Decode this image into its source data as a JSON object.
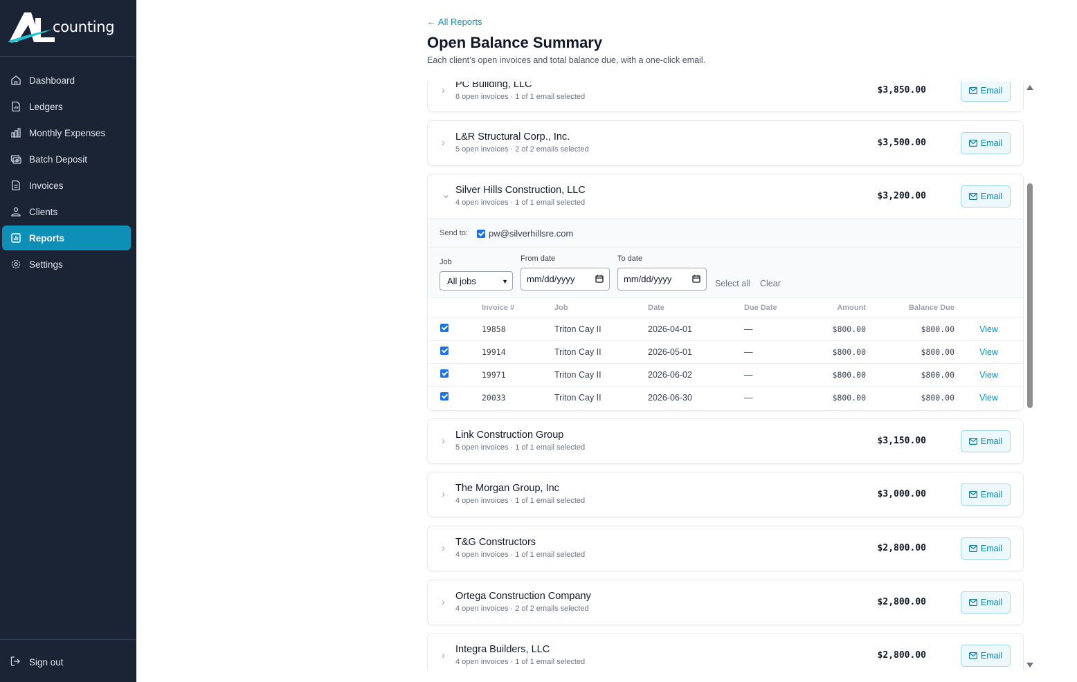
{
  "app": {
    "logo_letters": "AL",
    "logo_text": "counting"
  },
  "sidebar": {
    "items": [
      {
        "label": "Dashboard",
        "icon": "home-icon"
      },
      {
        "label": "Ledgers",
        "icon": "ledger-icon"
      },
      {
        "label": "Monthly Expenses",
        "icon": "bar-chart-icon"
      },
      {
        "label": "Batch Deposit",
        "icon": "deposit-icon"
      },
      {
        "label": "Invoices",
        "icon": "document-icon"
      },
      {
        "label": "Clients",
        "icon": "users-icon"
      },
      {
        "label": "Reports",
        "icon": "report-icon",
        "active": true
      },
      {
        "label": "Settings",
        "icon": "gear-icon"
      }
    ],
    "signout_label": "Sign out"
  },
  "header": {
    "back_link": "← All Reports",
    "title": "Open Balance Summary",
    "subtitle": "Each client’s open invoices and total balance due, with a one-click email."
  },
  "email_button_label": "Email",
  "clients": [
    {
      "name": "PC Building, LLC",
      "meta": "6 open invoices · 1 of 1 email selected",
      "balance": "$3,850.00"
    },
    {
      "name": "L&R Structural Corp., Inc.",
      "meta": "5 open invoices · 2 of 2 emails selected",
      "balance": "$3,500.00"
    },
    {
      "name": "Silver Hills Construction, LLC",
      "meta": "4 open invoices · 1 of 1 email selected",
      "balance": "$3,200.00",
      "expanded": true
    },
    {
      "name": "Link Construction Group",
      "meta": "5 open invoices · 1 of 1 email selected",
      "balance": "$3,150.00"
    },
    {
      "name": "The Morgan Group, Inc",
      "meta": "4 open invoices · 1 of 1 email selected",
      "balance": "$3,000.00"
    },
    {
      "name": "T&G Constructors",
      "meta": "4 open invoices · 1 of 1 email selected",
      "balance": "$2,800.00"
    },
    {
      "name": "Ortega Construction Company",
      "meta": "4 open invoices · 2 of 2 emails selected",
      "balance": "$2,800.00"
    },
    {
      "name": "Integra Builders, LLC",
      "meta": "4 open invoices · 1 of 1 email selected",
      "balance": "$2,800.00"
    }
  ],
  "expanded": {
    "send_to_label": "Send to:",
    "send_to_email": "pw@silverhillsre.com",
    "job_label": "Job",
    "job_value": "All jobs",
    "from_label": "From date",
    "to_label": "To date",
    "date_placeholder": "mm/dd/yyyy",
    "select_all": "Select all",
    "clear": "Clear",
    "columns": [
      "Invoice #",
      "Job",
      "Date",
      "Due Date",
      "Amount",
      "Balance Due"
    ],
    "rows": [
      {
        "invoice": "19858",
        "job": "Triton Cay II",
        "date": "2026-04-01",
        "due": "—",
        "amount": "$800.00",
        "balance": "$800.00",
        "action": "View"
      },
      {
        "invoice": "19914",
        "job": "Triton Cay II",
        "date": "2026-05-01",
        "due": "—",
        "amount": "$800.00",
        "balance": "$800.00",
        "action": "View"
      },
      {
        "invoice": "19971",
        "job": "Triton Cay II",
        "date": "2026-06-02",
        "due": "—",
        "amount": "$800.00",
        "balance": "$800.00",
        "action": "View"
      },
      {
        "invoice": "20033",
        "job": "Triton Cay II",
        "date": "2026-06-30",
        "due": "—",
        "amount": "$800.00",
        "balance": "$800.00",
        "action": "View"
      }
    ]
  },
  "colors": {
    "sidebar_bg": "#1b2434",
    "accent": "#0e8fb8",
    "checkbox": "#1a73e8"
  }
}
